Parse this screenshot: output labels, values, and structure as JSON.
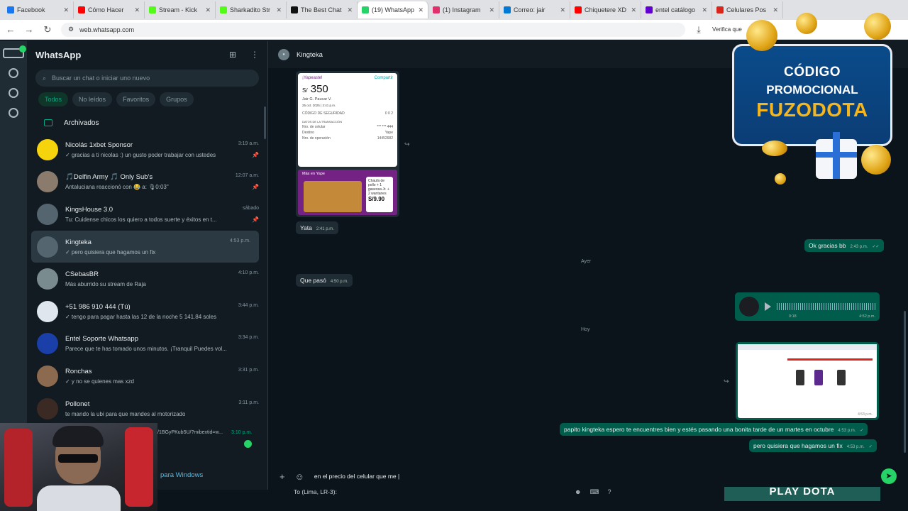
{
  "browser": {
    "tabs": [
      {
        "title": "Facebook",
        "color": "#1877f2"
      },
      {
        "title": "Cómo Hacer",
        "color": "#ff0000"
      },
      {
        "title": "Stream - Kick",
        "color": "#53fc18"
      },
      {
        "title": "Sharkadito Str",
        "color": "#53fc18"
      },
      {
        "title": "The Best Chat",
        "color": "#111111"
      },
      {
        "title": "(19) WhatsApp",
        "color": "#25d366",
        "active": true
      },
      {
        "title": "(1) Instagram",
        "color": "#e1306c"
      },
      {
        "title": "Correo: jair",
        "color": "#0078d4"
      },
      {
        "title": "Chiquetere XD",
        "color": "#ff0000"
      },
      {
        "title": "entel catálogo",
        "color": "#6001d2"
      },
      {
        "title": "Celulares Pos",
        "color": "#d9261c"
      }
    ],
    "url": "web.whatsapp.com",
    "profile_label": "Verifica que"
  },
  "sidebar": {
    "title": "WhatsApp",
    "search_placeholder": "Buscar un chat o iniciar uno nuevo",
    "filters": [
      "Todos",
      "No leídos",
      "Favoritos",
      "Grupos"
    ],
    "archived_label": "Archivados",
    "chats": [
      {
        "name": "Nicolás 1xbet Sponsor",
        "time": "3:19 a.m.",
        "msg": "✓ gracias a ti nicolas :) un gusto poder trabajar con ustedes",
        "pinned": true,
        "color": "#f5d40d"
      },
      {
        "name": "🎵Delfin Army 🎵 Only Sub's",
        "time": "12:07 a.m.",
        "msg": "Antaluciana reaccionó con 😂 a: 🎙0:03\"",
        "pinned": true,
        "color": "#8a7b6c"
      },
      {
        "name": "KingsHouse 3.0",
        "time": "sábado",
        "msg": "Tu: Cuidense chicos los quiero a todos suerte y éxitos en t...",
        "pinned": true,
        "color": "#54656f"
      },
      {
        "name": "Kingteka",
        "time": "4:53 p.m.",
        "msg": "✓ pero quisiera que hagamos un fix",
        "pinned": false,
        "color": "#54656f",
        "selected": true
      },
      {
        "name": "CSebasBR",
        "time": "4:10 p.m.",
        "msg": "Más aburrido su stream de Raja",
        "pinned": false,
        "color": "#7a8b8f"
      },
      {
        "name": "+51 986 910 444 (Tú)",
        "time": "3:44 p.m.",
        "msg": "✓ tengo para pagar hasta las 12 de la noche 5   141.84 soles",
        "pinned": false,
        "color": "#dfe6ee"
      },
      {
        "name": "Entel Soporte Whatsapp",
        "time": "3:34 p.m.",
        "msg": "Parece que te has tomado unos minutos. ¡Tranquil Puedes vol...",
        "pinned": false,
        "color": "#1b3fa8"
      },
      {
        "name": "Ronchas",
        "time": "3:31 p.m.",
        "msg": "✓ y no se quienes mas xzd",
        "pinned": false,
        "color": "#8b6a4f"
      },
      {
        "name": "Pollonet",
        "time": "3:11 p.m.",
        "msg": "te mando la ubi para que mandes al motorizado",
        "pinned": false,
        "color": "#3b2a24"
      }
    ],
    "partial_chat": {
      "msg": "/1BGyPKub5U/?mibextid=w...",
      "time": "3:10 p.m."
    },
    "windows_link": "para Windows"
  },
  "chat": {
    "title": "Kingteka",
    "receipt": {
      "header": "¡Yapeaste!",
      "share": "Compartir",
      "currency": "S/",
      "amount": "350",
      "name": "Jair G. Paucar V.",
      "date": "25 oct. 2025 | 2:41 p.m.",
      "code_label": "CÓDIGO DE SEGURIDAD",
      "code": "0 0 2",
      "details_label": "DATOS DE LA TRANSACCIÓN",
      "rows": [
        {
          "k": "Nro. de celular",
          "v": "*** *** 444"
        },
        {
          "k": "Destino",
          "v": "Yape"
        },
        {
          "k": "Nro. de operación",
          "v": "14452682"
        }
      ],
      "promo_label": "Más en Yape",
      "deal_text": "Chaufa de pollo + 1 gaseosa Jr. + 2 wantanes",
      "deal_price": "S/9.90",
      "time": "2:41 p.m."
    },
    "messages": [
      {
        "id": "yata",
        "text": "Yata",
        "time": "2:41 p.m.",
        "dir": "in"
      },
      {
        "id": "ok",
        "text": "Ok gracias bb",
        "time": "2:43 p.m.",
        "dir": "out"
      },
      {
        "id": "quepaso",
        "text": "Que pasó",
        "time": "4:50 p.m.",
        "dir": "in"
      },
      {
        "id": "papito",
        "text": "papito kingteka espero te encuentres bien y estés pasando una bonita tarde  de un martes en octubre",
        "time": "4:53 p.m.",
        "dir": "out"
      },
      {
        "id": "fix",
        "text": "pero quisiera que hagamos un fix",
        "time": "4:53 p.m.",
        "dir": "out"
      }
    ],
    "days": {
      "yesterday": "Ayer",
      "today": "Hoy"
    },
    "audio": {
      "duration": "0:18",
      "time": "4:52 p.m."
    },
    "image_time": "4:53 p.m.",
    "composer_text": "en el precio del celular que me |"
  },
  "statusbar": {
    "text": "To (Lima, LR-3):"
  },
  "overlays": {
    "promo_line1": "CÓDIGO",
    "promo_line2": "PROMOCIONAL",
    "promo_line3": "FUZODOTA",
    "play_button": "PLAY DOTA"
  }
}
